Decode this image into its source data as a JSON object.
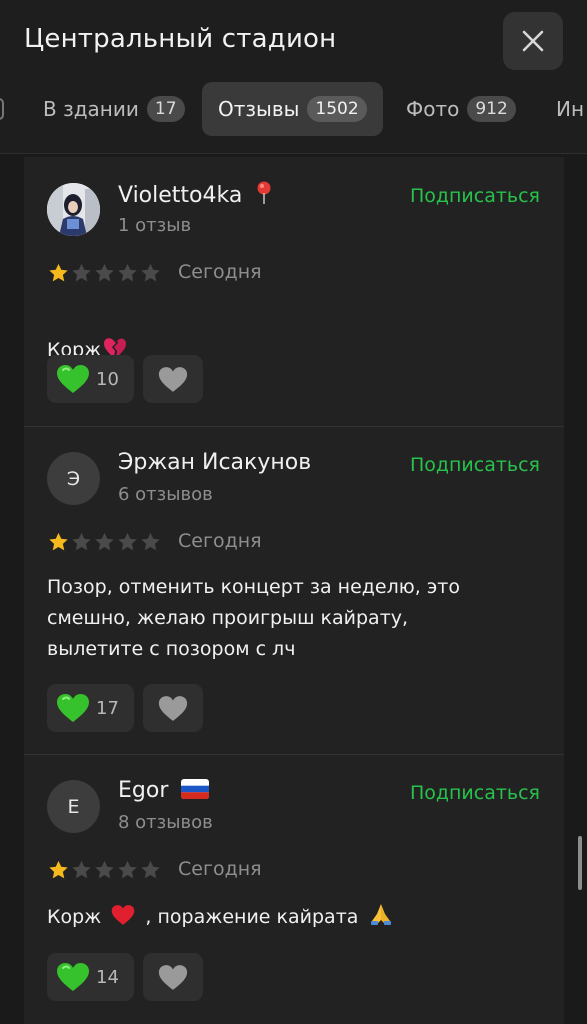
{
  "header": {
    "title": "Центральный стадион",
    "close_icon": "close-icon"
  },
  "tabs": [
    {
      "label": "",
      "badge": "",
      "state": "clipped"
    },
    {
      "label": "В здании",
      "badge": "17",
      "state": "inactive"
    },
    {
      "label": "Отзывы",
      "badge": "1502",
      "state": "active"
    },
    {
      "label": "Фото",
      "badge": "912",
      "state": "inactive"
    },
    {
      "label": "Ин",
      "badge": "",
      "state": "clipped"
    }
  ],
  "reviews": [
    {
      "author": "Violetto4ka",
      "author_badge_icon": "pin-icon",
      "reviews_count": "1 отзыв",
      "avatar_letter": "",
      "avatar_type": "photo",
      "subscribe_label": "Подписаться",
      "rating": 1,
      "max_rating": 5,
      "date": "Сегодня",
      "text": "Корж",
      "text_emoji": "broken-heart-icon",
      "likes": "10"
    },
    {
      "author": "Эржан Исакунов",
      "author_badge_icon": "",
      "reviews_count": "6 отзывов",
      "avatar_letter": "Э",
      "avatar_type": "letter",
      "subscribe_label": "Подписаться",
      "rating": 1,
      "max_rating": 5,
      "date": "Сегодня",
      "text": "Позор, отменить концерт за неделю, это\nсмешно, желаю проигрыш кайрату,\nвылетите с позором с лч",
      "likes": "17"
    },
    {
      "author": "Egor",
      "author_badge_icon": "russia-flag-icon",
      "reviews_count": "8 отзывов",
      "avatar_letter": "E",
      "avatar_type": "letter",
      "subscribe_label": "Подписаться",
      "rating": 1,
      "max_rating": 5,
      "date": "Сегодня",
      "text_part1": "Корж",
      "text_part2": ", поражение кайрата",
      "text_icons": [
        "red-heart-icon",
        "folded-hands-icon"
      ],
      "likes": "14"
    }
  ],
  "colors": {
    "accent_green": "#27c24c",
    "star_filled": "#f5b91e",
    "star_empty": "#4a4a4a",
    "like_heart": "#36c22c"
  }
}
